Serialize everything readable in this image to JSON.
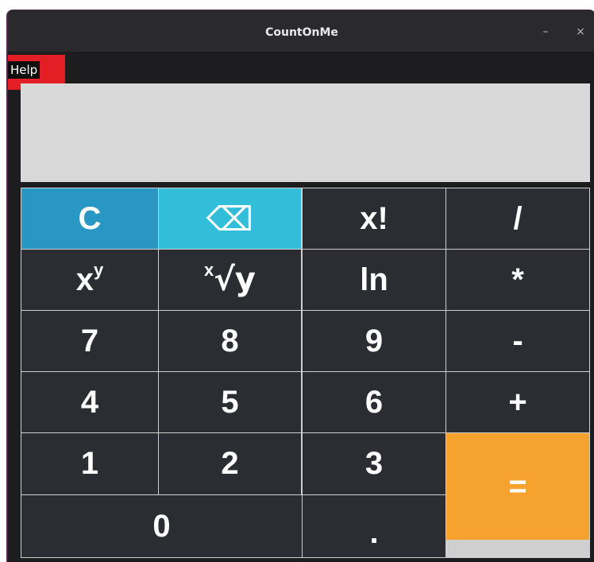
{
  "window": {
    "title": "CountOnMe",
    "minimize_glyph": "–",
    "close_glyph": "×"
  },
  "menu": {
    "help_label": "Help"
  },
  "display": {
    "value": ""
  },
  "keys": {
    "clear": "C",
    "backspace": "⌫",
    "factorial": "x!",
    "divide": "/",
    "power_base": "x",
    "power_exp": "y",
    "root_index": "x",
    "root_body": "√y",
    "ln": "ln",
    "multiply": "*",
    "seven": "7",
    "eight": "8",
    "nine": "9",
    "minus": "-",
    "four": "4",
    "five": "5",
    "six": "6",
    "plus": "+",
    "one": "1",
    "two": "2",
    "three": "3",
    "equals": "=",
    "zero": "0",
    "dot": "."
  },
  "colors": {
    "clear_key": "#2997c4",
    "backspace_key": "#32bdd8",
    "equals_key": "#f5a32e",
    "key_background": "#2c2d33",
    "display_background": "#d9d9d9",
    "menu_highlight": "#e31e24"
  }
}
